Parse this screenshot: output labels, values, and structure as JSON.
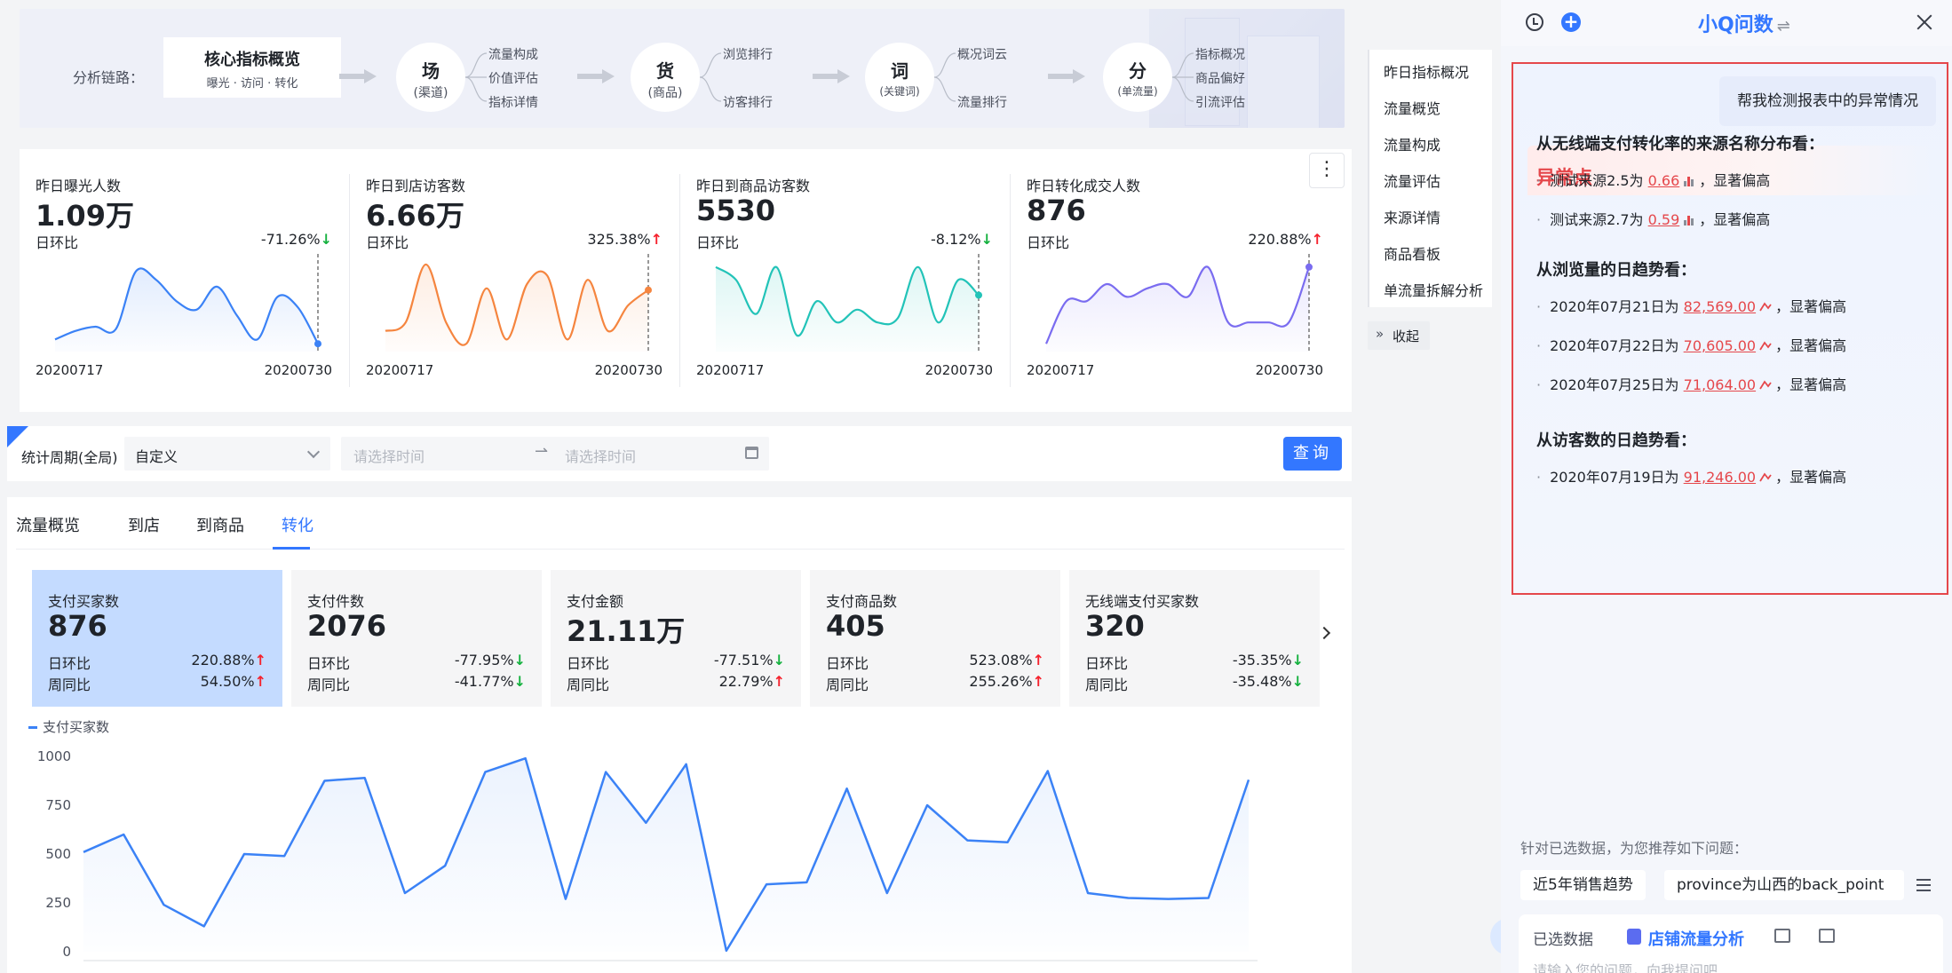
{
  "chain": {
    "label": "分析链路：",
    "core_title": "核心指标概览",
    "core_sub": "曝光 · 访问 · 转化",
    "nodes": [
      {
        "char": "场",
        "sub": "(渠道)",
        "branches": [
          "流量构成",
          "价值评估",
          "指标详情"
        ]
      },
      {
        "char": "货",
        "sub": "(商品)",
        "branches": [
          "浏览排行",
          "访客排行"
        ]
      },
      {
        "char": "词",
        "sub": "(关键词)",
        "branches": [
          "概况词云",
          "流量排行"
        ]
      },
      {
        "char": "分",
        "sub": "(单流量)",
        "branches": [
          "指标概况",
          "商品偏好",
          "引流评估"
        ]
      }
    ]
  },
  "kpis": [
    {
      "name": "昨日曝光人数",
      "value": "1.09万",
      "compare_label": "日环比",
      "pct": "-71.26%",
      "dir": "down",
      "start": "20200717",
      "end": "20200730",
      "color": "#3b82f6",
      "spark": [
        0.1,
        0.2,
        0.25,
        0.22,
        0.9,
        0.8,
        0.55,
        0.45,
        0.72,
        0.38,
        0.1,
        0.6,
        0.48,
        0.05
      ]
    },
    {
      "name": "昨日到店访客数",
      "value": "6.66万",
      "compare_label": "日环比",
      "pct": "325.38%",
      "dir": "up",
      "start": "20200717",
      "end": "20200730",
      "color": "#f5853f",
      "spark": [
        0.2,
        0.3,
        0.98,
        0.3,
        0.05,
        0.7,
        0.1,
        0.75,
        0.85,
        0.1,
        0.8,
        0.2,
        0.5,
        0.68
      ]
    },
    {
      "name": "昨日到商品访客数",
      "value": "5530",
      "compare_label": "日环比",
      "pct": "-8.12%",
      "dir": "down",
      "start": "20200717",
      "end": "20200730",
      "color": "#22c3b8",
      "spark": [
        0.95,
        0.8,
        0.4,
        0.95,
        0.15,
        0.55,
        0.3,
        0.45,
        0.3,
        0.35,
        0.95,
        0.3,
        0.8,
        0.62
      ]
    },
    {
      "name": "昨日转化成交人数",
      "value": "876",
      "compare_label": "日环比",
      "pct": "220.88%",
      "dir": "up",
      "start": "20200717",
      "end": "20200730",
      "color": "#7a6cf0",
      "spark": [
        0.05,
        0.55,
        0.55,
        0.75,
        0.6,
        0.7,
        0.75,
        0.6,
        0.95,
        0.3,
        0.3,
        0.3,
        0.3,
        0.95
      ]
    }
  ],
  "filter": {
    "label": "统计周期(全局)",
    "select_value": "自定义",
    "start_placeholder": "请选择时间",
    "end_placeholder": "请选择时间",
    "query_label": "查询"
  },
  "tabs": [
    "流量概览",
    "到店",
    "到商品",
    "转化"
  ],
  "active_tab": 3,
  "cards": [
    {
      "name": "支付买家数",
      "value": "876",
      "day_label": "日环比",
      "day": "220.88%",
      "day_dir": "up",
      "week_label": "周同比",
      "week": "54.50%",
      "week_dir": "up",
      "active": true
    },
    {
      "name": "支付件数",
      "value": "2076",
      "day_label": "日环比",
      "day": "-77.95%",
      "day_dir": "down",
      "week_label": "周同比",
      "week": "-41.77%",
      "week_dir": "down",
      "active": false
    },
    {
      "name": "支付金额",
      "value": "21.11万",
      "day_label": "日环比",
      "day": "-77.51%",
      "day_dir": "down",
      "week_label": "周同比",
      "week": "22.79%",
      "week_dir": "up",
      "active": false
    },
    {
      "name": "支付商品数",
      "value": "405",
      "day_label": "日环比",
      "day": "523.08%",
      "day_dir": "up",
      "week_label": "周同比",
      "week": "255.26%",
      "week_dir": "up",
      "active": false
    },
    {
      "name": "无线端支付买家数",
      "value": "320",
      "day_label": "日环比",
      "day": "-35.35%",
      "day_dir": "down",
      "week_label": "周同比",
      "week": "-35.48%",
      "week_dir": "down",
      "active": false
    }
  ],
  "chart_data": {
    "type": "area",
    "series": [
      {
        "name": "支付买家数",
        "values": [
          510,
          600,
          240,
          130,
          500,
          490,
          875,
          890,
          300,
          440,
          920,
          990,
          270,
          920,
          660,
          960,
          5,
          345,
          355,
          835,
          300,
          750,
          570,
          560,
          925,
          300,
          275,
          270,
          275,
          880
        ]
      }
    ],
    "yticks": [
      "1000",
      "750",
      "500",
      "250",
      "0"
    ],
    "ylim": [
      0,
      1000
    ],
    "grid": false,
    "legend": "top-left",
    "color": "#3b82f6"
  },
  "right_nav": {
    "items": [
      "昨日指标概况",
      "流量概览",
      "流量构成",
      "流量评估",
      "来源详情",
      "商品看板",
      "单流量拆解分析"
    ],
    "collapse_label": "收起"
  },
  "chat": {
    "title": "小Q问数",
    "user_message": "帮我检测报表中的异常情况",
    "anomaly_title": "异常点",
    "sections": [
      {
        "title": "从无线端支付转化率的来源名称分布看：",
        "items": [
          {
            "pre": "测试来源2.5为",
            "value": "0.66",
            "marker": "bar",
            "post": "，显著偏高"
          },
          {
            "pre": "测试来源2.7为",
            "value": "0.59",
            "marker": "bar",
            "post": "，显著偏高"
          }
        ]
      },
      {
        "title": "从浏览量的日趋势看：",
        "items": [
          {
            "pre": "2020年07月21日为",
            "value": "82,569.00",
            "marker": "line",
            "post": "，显著偏高"
          },
          {
            "pre": "2020年07月22日为",
            "value": "70,605.00",
            "marker": "line",
            "post": "，显著偏高"
          },
          {
            "pre": "2020年07月25日为",
            "value": "71,064.00",
            "marker": "line",
            "post": "，显著偏高"
          }
        ]
      },
      {
        "title": "从访客数的日趋势看：",
        "items": [
          {
            "pre": "2020年07月19日为",
            "value": "91,246.00",
            "marker": "line",
            "post": "，显著偏高"
          }
        ]
      }
    ],
    "suggest_label": "针对已选数据，为您推荐如下问题：",
    "chips": [
      "近5年销售趋势",
      "province为山西的back_point"
    ],
    "selected_label": "已选数据",
    "dataset": "店铺流量分析",
    "input_placeholder": "请输入您的问题，向我提问吧"
  },
  "colors": {
    "accent": "#3377ff",
    "up": "#f5222d",
    "down": "#14b13e",
    "alert": "#e5474b"
  }
}
